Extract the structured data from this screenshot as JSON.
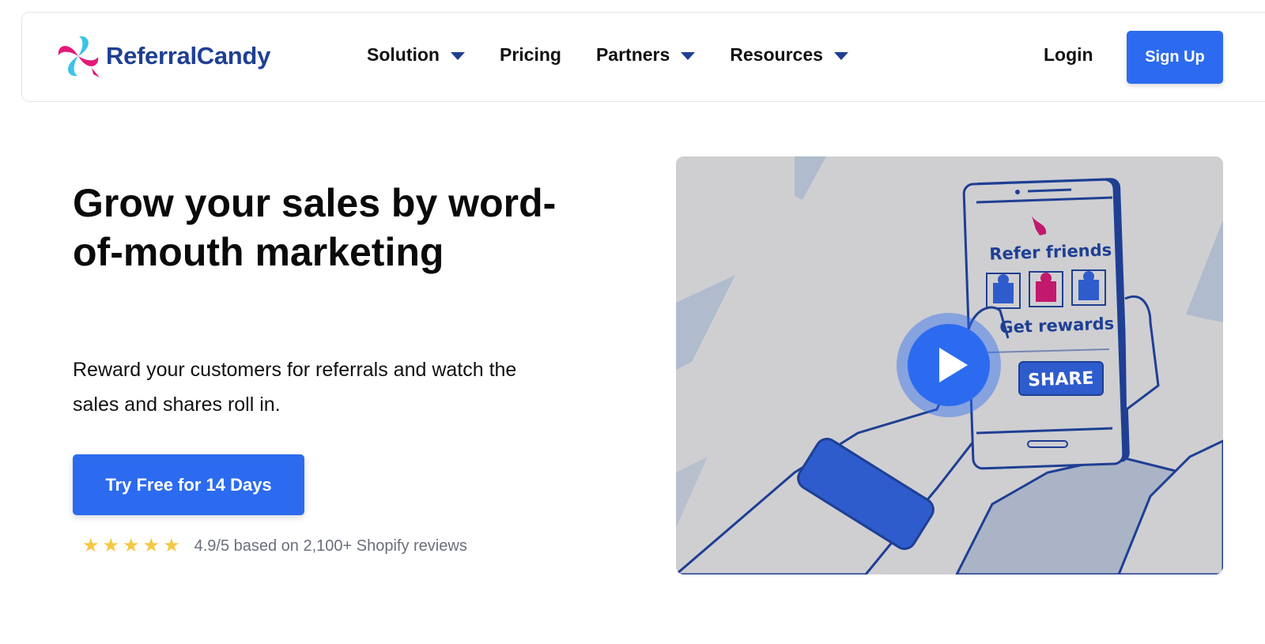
{
  "header": {
    "brand": "ReferralCandy",
    "nav": [
      {
        "label": "Solution",
        "dropdown": true
      },
      {
        "label": "Pricing",
        "dropdown": false
      },
      {
        "label": "Partners",
        "dropdown": true
      },
      {
        "label": "Resources",
        "dropdown": true
      }
    ],
    "login_label": "Login",
    "signup_label": "Sign Up"
  },
  "hero": {
    "headline": "Grow your sales by word-of-mouth marketing",
    "subtext": "Reward your customers for referrals and watch the sales and shares roll in.",
    "cta_label": "Try Free for 14 Days",
    "rating": {
      "stars": 5,
      "text": "4.9/5 based on 2,100+ Shopify reviews"
    }
  },
  "video": {
    "phone_title": "Refer friends",
    "phone_subtitle": "Get rewards",
    "phone_button": "SHARE"
  },
  "colors": {
    "accent": "#2c6bef",
    "brand_text": "#1f3f93",
    "star": "#f5c842",
    "pink": "#e5197a",
    "cyan": "#3ec3e8"
  },
  "icons": [
    "logo-icon",
    "chevron-down-icon",
    "star-icon",
    "play-icon",
    "gift-icon"
  ]
}
